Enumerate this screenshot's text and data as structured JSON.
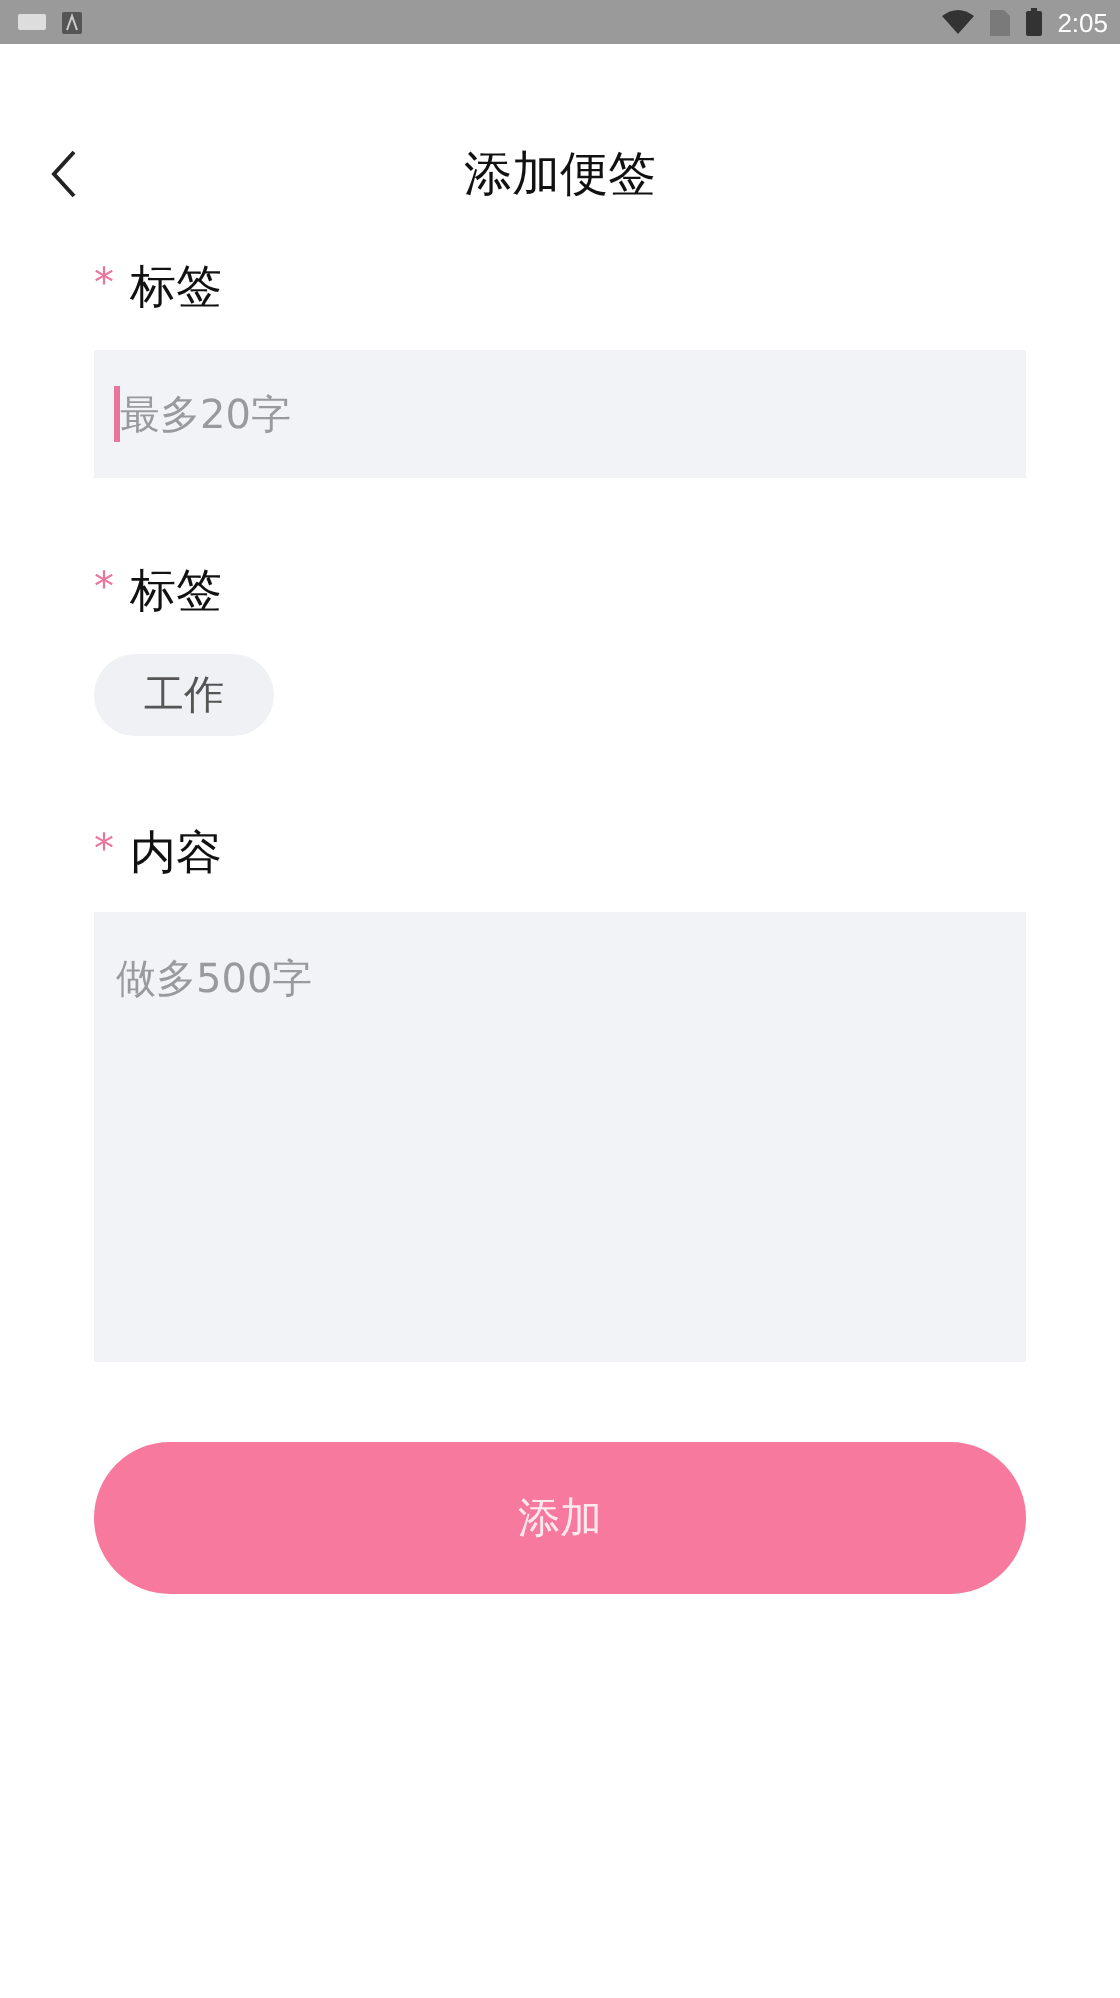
{
  "status_bar": {
    "time": "2:05"
  },
  "header": {
    "title": "添加便签"
  },
  "form": {
    "title_field": {
      "required_mark": "*",
      "label": "标签",
      "placeholder": "最多20字",
      "focused": true
    },
    "tags": {
      "required_mark": "*",
      "label": "标签",
      "items": [
        {
          "label": "工作"
        }
      ]
    },
    "content_field": {
      "required_mark": "*",
      "label": "内容",
      "placeholder": "做多500字"
    }
  },
  "submit_button": {
    "label": "添加"
  }
}
